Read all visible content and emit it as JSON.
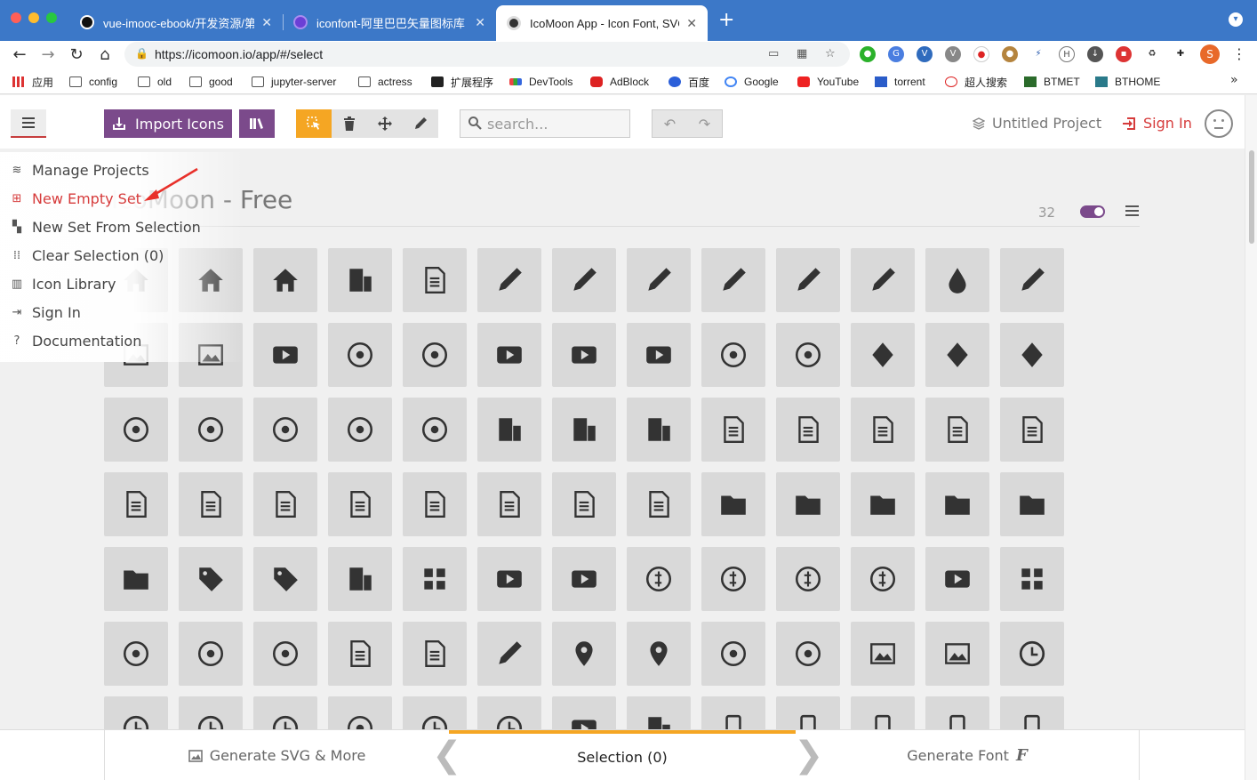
{
  "browser": {
    "tabs": [
      {
        "title": "vue-imooc-ebook/开发资源/第三",
        "icon": "github-icon",
        "active": false
      },
      {
        "title": "iconfont-阿里巴巴矢量图标库",
        "icon": "iconfont-icon",
        "active": false
      },
      {
        "title": "IcoMoon App - Icon Font, SVG,",
        "icon": "icomoon-icon",
        "active": true
      }
    ],
    "close_glyph": "✕",
    "new_tab": "+",
    "url": "https://icomoon.io/app/#/select",
    "profile_initial": "S",
    "bookmarks": [
      {
        "label": "应用",
        "icon": "apps-grid-icon"
      },
      {
        "label": "config",
        "icon": "folder-icon"
      },
      {
        "label": "old",
        "icon": "folder-icon"
      },
      {
        "label": "good",
        "icon": "folder-icon"
      },
      {
        "label": "jupyter-server",
        "icon": "folder-icon"
      },
      {
        "label": "actress",
        "icon": "folder-icon"
      },
      {
        "label": "扩展程序",
        "icon": "puzzle-icon"
      },
      {
        "label": "DevTools",
        "icon": "devtools-icon"
      },
      {
        "label": "AdBlock",
        "icon": "adblock-icon"
      },
      {
        "label": "百度",
        "icon": "baidu-icon"
      },
      {
        "label": "Google",
        "icon": "google-icon"
      },
      {
        "label": "YouTube",
        "icon": "youtube-icon"
      },
      {
        "label": "torrent",
        "icon": "torrent-icon"
      },
      {
        "label": "超人搜索",
        "icon": "chaoren-icon"
      },
      {
        "label": "BTMET",
        "icon": "btmet-icon"
      },
      {
        "label": "BTHOME",
        "icon": "bthome-icon"
      }
    ]
  },
  "app": {
    "import_label": "Import Icons",
    "search_placeholder": "search...",
    "project_name": "Untitled Project",
    "sign_in": "Sign In",
    "menu": [
      {
        "label": "Manage Projects",
        "icon": "layers-icon",
        "highlight": false
      },
      {
        "label": "New Empty Set",
        "icon": "plus-square-icon",
        "highlight": true
      },
      {
        "label": "New Set From Selection",
        "icon": "selection-grid-icon",
        "highlight": false
      },
      {
        "label": "Clear Selection (0)",
        "icon": "dots-grid-icon",
        "highlight": false
      },
      {
        "label": "Icon Library",
        "icon": "library-icon",
        "highlight": false
      },
      {
        "label": "Sign In",
        "icon": "sign-in-icon",
        "highlight": false
      },
      {
        "label": "Documentation",
        "icon": "question-circle-icon",
        "highlight": false
      }
    ],
    "set": {
      "title": "IcoMoon - Free",
      "count": "32"
    },
    "bottom": {
      "generate_svg": "Generate SVG & More",
      "selection": "Selection (0)",
      "generate_font": "Generate Font"
    },
    "icons": [
      [
        "home",
        "home2",
        "home3",
        "office",
        "newspaper",
        "pencil",
        "pencil2",
        "quill",
        "pen",
        "blog",
        "eyedropper",
        "droplet",
        "paint-format"
      ],
      [
        "image",
        "images",
        "camera",
        "headphones",
        "music",
        "play",
        "film",
        "video-camera",
        "dice",
        "pacman",
        "spades",
        "clubs",
        "diamonds"
      ],
      [
        "bullhorn",
        "connection",
        "podcast",
        "feed",
        "mic",
        "book",
        "books",
        "library",
        "file-text",
        "profile",
        "file-empty",
        "files-empty",
        "file-text2"
      ],
      [
        "file-picture",
        "file-music",
        "file-play",
        "file-video",
        "file-zip",
        "copy",
        "paste",
        "stack",
        "folder",
        "folder-open",
        "folder-plus",
        "folder-minus",
        "folder-download"
      ],
      [
        "folder-upload",
        "price-tag",
        "price-tags",
        "barcode",
        "qrcode",
        "ticket",
        "cart",
        "coin-dollar",
        "coin-euro",
        "coin-pound",
        "coin-yen",
        "credit-card",
        "calculator"
      ],
      [
        "lifebuoy",
        "phone",
        "phone-hang-up",
        "address-book",
        "envelop",
        "pushpin",
        "location",
        "location2",
        "compass",
        "compass2",
        "map",
        "map2",
        "history"
      ],
      [
        "clock",
        "clock2",
        "alarm",
        "bell",
        "stopwatch",
        "calendar",
        "printer",
        "keyboard",
        "display",
        "laptop",
        "mobile",
        "mobile2",
        "tablet"
      ]
    ]
  }
}
